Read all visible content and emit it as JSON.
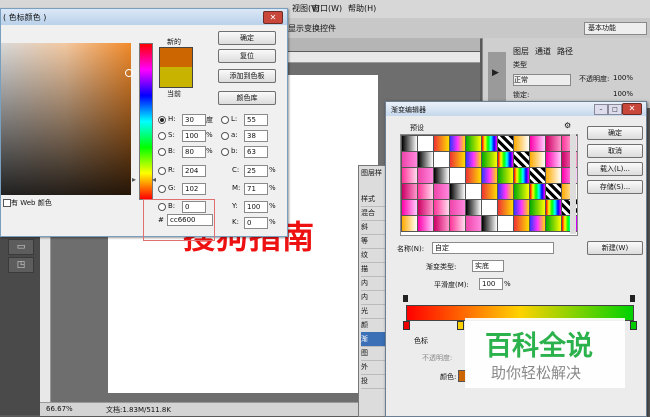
{
  "menu": [
    "视图(V)",
    "窗口(W)",
    "帮助(H)"
  ],
  "options_bar": {
    "show_transform": "显示变换控件",
    "workspace": "基本功能"
  },
  "status": {
    "zoom": "66.67%",
    "doc_info": "文档:1.83M/511.8K"
  },
  "canvas_text": "搜狗指南",
  "right_panel": {
    "tabs": [
      "图层",
      "通道",
      "路径"
    ],
    "kind": "类型",
    "blend": "正常",
    "opacity_label": "不透明度:",
    "opacity": "100%",
    "lock_label": "锁定:",
    "fill": "100%"
  },
  "styles_panel": {
    "title": "图层样",
    "items": [
      "样式",
      "混合",
      "斜",
      "等",
      "纹",
      "描",
      "内",
      "内",
      "光",
      "颜",
      "渐",
      "图",
      "外",
      "投"
    ]
  },
  "picker": {
    "title": "( 色标颜色 )",
    "ok": "确定",
    "reset": "复位",
    "add_swatch": "添加到色板",
    "color_library": "颜色库",
    "new_label": "新的",
    "current_label": "当前",
    "new_color": "#cc6600",
    "current_color": "#c8b400",
    "web_only": "有 Web 颜色",
    "H": {
      "label": "H:",
      "value": "30",
      "unit": "度"
    },
    "S": {
      "label": "S:",
      "value": "100",
      "unit": "%"
    },
    "Bv": {
      "label": "B:",
      "value": "80",
      "unit": "%"
    },
    "R": {
      "label": "R:",
      "value": "204"
    },
    "G": {
      "label": "G:",
      "value": "102"
    },
    "Bc": {
      "label": "B:",
      "value": "0"
    },
    "L": {
      "label": "L:",
      "value": "55"
    },
    "a": {
      "label": "a:",
      "value": "38"
    },
    "b": {
      "label": "b:",
      "value": "63"
    },
    "C": {
      "label": "C:",
      "value": "25",
      "unit": "%"
    },
    "M": {
      "label": "M:",
      "value": "71",
      "unit": "%"
    },
    "Y": {
      "label": "Y:",
      "value": "100",
      "unit": "%"
    },
    "K": {
      "label": "K:",
      "value": "0",
      "unit": "%"
    },
    "hex_label": "#",
    "hex": "cc6600"
  },
  "gradient_editor": {
    "title": "渐变编辑器",
    "presets_label": "预设",
    "ok": "确定",
    "cancel": "取消",
    "load": "载入(L)...",
    "save": "存储(S)...",
    "name_label": "名称(N):",
    "name_value": "自定",
    "new_button": "新建(W)",
    "type_label": "渐变类型:",
    "type_value": "实底",
    "smooth_label": "平滑度(M):",
    "smooth_value": "100",
    "smooth_unit": "%",
    "stops_label": "色标",
    "opacity_label": "不透明度:",
    "color_label": "颜色:",
    "stop_color": "#cc6600"
  },
  "watermark": {
    "title": "百科全说",
    "subtitle": "助你轻松解决"
  }
}
